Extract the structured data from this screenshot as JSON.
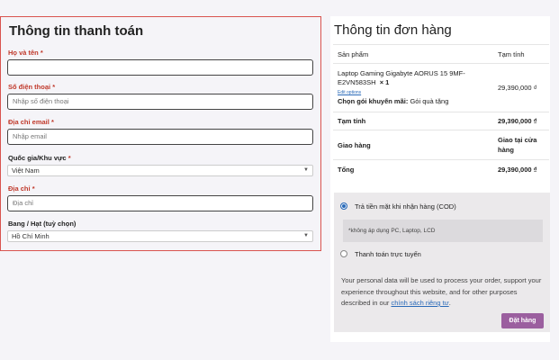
{
  "billing": {
    "title": "Thông tin thanh toán",
    "name_label": "Họ và tên",
    "phone_label": "Số điện thoại",
    "phone_placeholder": "Nhập số điện thoại",
    "email_label": "Địa chỉ email",
    "email_placeholder": "Nhập email",
    "country_label": "Quốc gia/Khu vực",
    "country_value": "Việt Nam",
    "address_label": "Địa chỉ",
    "address_placeholder": "Địa chỉ",
    "state_label": "Bang / Hạt (tuỳ chọn)",
    "state_value": "Hồ Chí Minh",
    "required_mark": "*"
  },
  "order": {
    "title": "Thông tin đơn hàng",
    "col_product": "Sản phẩm",
    "col_subtotal": "Tạm tính",
    "product_name": "Laptop Gaming Gigabyte AORUS 15 9MF-E2VN583SH",
    "product_qty": "× 1",
    "edit_options": "Edit options",
    "promo_label": "Chọn gói khuyến mãi:",
    "promo_value": "Gói quà tặng",
    "product_price": "29,390,000 ₫",
    "subtotal_label": "Tạm tính",
    "subtotal_value": "29,390,000 ₫",
    "shipping_label": "Giao hàng",
    "shipping_value": "Giao tại cửa hàng",
    "total_label": "Tổng",
    "total_value": "29,390,000 ₫"
  },
  "payment": {
    "cod_label": "Trả tiền mặt khi nhận hàng (COD)",
    "cod_note": "*không áp dụng PC, Laptop, LCD",
    "online_label": "Thanh toán trực tuyến",
    "privacy_text": "Your personal data will be used to process your order, support your experience throughout this website, and for other purposes described in our",
    "privacy_link": "chính sách riêng tư",
    "place_order": "Đặt hàng"
  }
}
